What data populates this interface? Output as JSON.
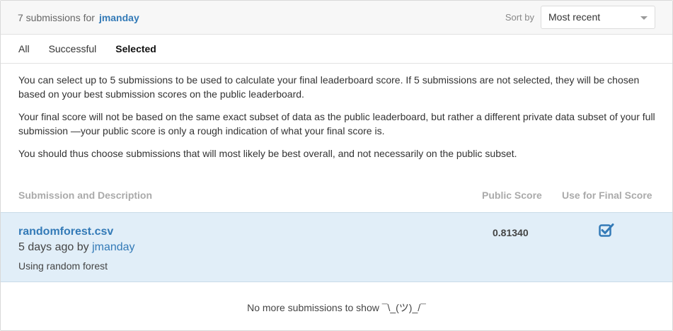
{
  "header": {
    "count_text": "7 submissions for",
    "username": "jmanday",
    "sort_label": "Sort by",
    "sort_value": "Most recent"
  },
  "tabs": [
    {
      "label": "All"
    },
    {
      "label": "Successful"
    },
    {
      "label": "Selected"
    }
  ],
  "active_tab": "Selected",
  "info": {
    "p1": "You can select up to 5 submissions to be used to calculate your final leaderboard score. If 5 submissions are not selected, they will be chosen based on your best submission scores on the public leaderboard.",
    "p2": "Your final score will not be based on the same exact subset of data as the public leaderboard, but rather a different private data subset of your full submission —your public score is only a rough indication of what your final score is.",
    "p3": "You should thus choose submissions that will most likely be best overall, and not necessarily on the public subset."
  },
  "table": {
    "col_desc": "Submission and Description",
    "col_score": "Public Score",
    "col_final": "Use for Final Score"
  },
  "submission": {
    "filename": "randomforest.csv",
    "time_text": "5 days ago by",
    "user": "jmanday",
    "description": "Using random forest",
    "public_score": "0.81340",
    "selected": true
  },
  "footer_text": "No more submissions to show ¯\\_(ツ)_/¯",
  "colors": {
    "accent": "#337ab7",
    "row_highlight": "#e1eef8"
  }
}
